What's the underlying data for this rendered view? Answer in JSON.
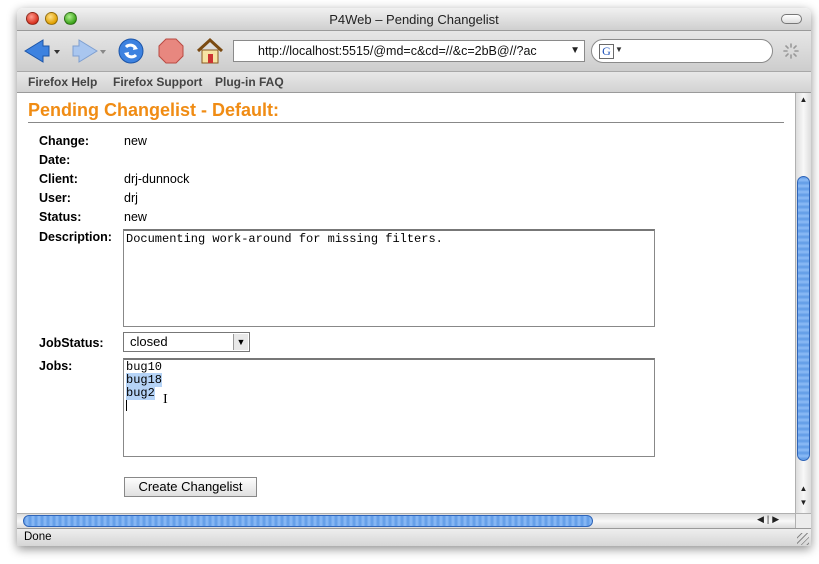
{
  "window": {
    "title": "P4Web – Pending Changelist"
  },
  "toolbar": {
    "url": "http://localhost:5515/@md=c&cd=//&c=2bB@//?ac",
    "url_dropdown_glyph": "▼",
    "search_engine_letter": "G"
  },
  "bookmarks": [
    {
      "label": "Firefox Help"
    },
    {
      "label": "Firefox Support"
    },
    {
      "label": "Plug-in FAQ"
    }
  ],
  "page": {
    "heading": "Pending Changelist - Default:",
    "fields": {
      "change": {
        "label": "Change:",
        "value": "new"
      },
      "date": {
        "label": "Date:",
        "value": ""
      },
      "client": {
        "label": "Client:",
        "value": "drj-dunnock"
      },
      "user": {
        "label": "User:",
        "value": "drj"
      },
      "status": {
        "label": "Status:",
        "value": "new"
      }
    },
    "description": {
      "label": "Description:",
      "value": "Documenting work-around for missing filters."
    },
    "job_status": {
      "label": "JobStatus:",
      "selected": "closed"
    },
    "jobs": {
      "label": "Jobs:",
      "items": [
        "bug10",
        "bug18",
        "bug2"
      ],
      "selected_items": [
        "bug18",
        "bug2"
      ]
    },
    "submit_label": "Create Changelist"
  },
  "statusbar": {
    "text": "Done"
  },
  "colors": {
    "heading": "#f08c14",
    "selection": "#b5d3f6",
    "scroll_thumb": "#5f9ae6"
  },
  "icons": [
    "back-icon",
    "forward-icon",
    "reload-icon",
    "stop-icon",
    "home-icon",
    "google-icon",
    "spinner-icon",
    "text-cursor-icon"
  ]
}
